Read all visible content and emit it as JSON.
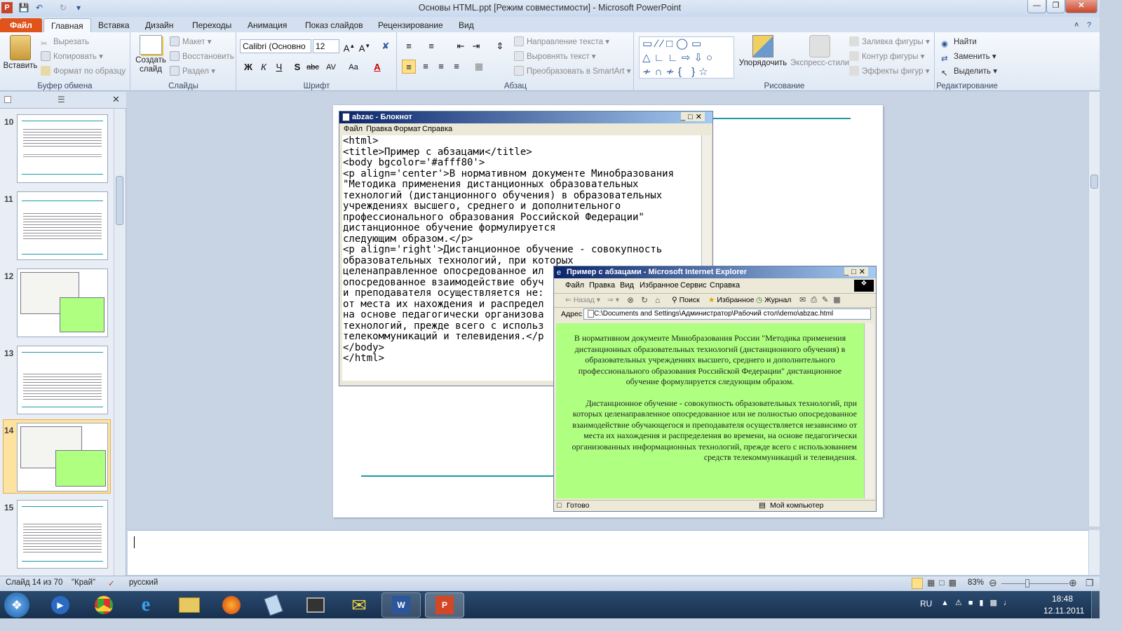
{
  "window": {
    "title": "Основы HTML.ppt [Режим совместимости]  -  Microsoft PowerPoint"
  },
  "tabs": [
    "Файл",
    "Главная",
    "Вставка",
    "Дизайн",
    "Переходы",
    "Анимация",
    "Показ слайдов",
    "Рецензирование",
    "Вид"
  ],
  "ribbon": {
    "clipboard": {
      "label": "Буфер обмена",
      "paste": "Вставить",
      "cut": "Вырезать",
      "copy": "Копировать",
      "format_painter": "Формат по образцу"
    },
    "slides": {
      "label": "Слайды",
      "new_slide": "Создать слайд",
      "layout": "Макет",
      "reset": "Восстановить",
      "section": "Раздел"
    },
    "font": {
      "label": "Шрифт",
      "font_name": "Calibri (Основно",
      "font_size": "12"
    },
    "paragraph": {
      "label": "Абзац",
      "text_direction": "Направление текста",
      "align_text": "Выровнять текст",
      "smartart": "Преобразовать в SmartArt"
    },
    "drawing": {
      "label": "Рисование",
      "arrange": "Упорядочить",
      "quick_styles": "Экспресс-стили",
      "shape_fill": "Заливка фигуры",
      "shape_outline": "Контур фигуры",
      "shape_effects": "Эффекты фигур"
    },
    "editing": {
      "label": "Редактирование",
      "find": "Найти",
      "replace": "Заменить",
      "select": "Выделить"
    }
  },
  "thumbnails": [
    {
      "num": "10"
    },
    {
      "num": "11"
    },
    {
      "num": "12"
    },
    {
      "num": "13"
    },
    {
      "num": "14"
    },
    {
      "num": "15"
    }
  ],
  "notepad": {
    "title": "abzac - Блокнот",
    "menu": [
      "Файл",
      "Правка",
      "Формат",
      "Справка"
    ],
    "text": "<html>\n<title>Пример с абзацами</title>\n<body bgcolor='#afff80'>\n<p align='center'>В нормативном документе Минобразования\n\"Методика применения дистанционных образовательных\nтехнологий (дистанционного обучения) в образовательных\nучреждениях высшего, среднего и дополнительного\nпрофессионального образования Российской Федерации\"\nдистанционное обучение формулируется\nследующим образом.</p>\n<p align='right'>Дистанционное обучение - совокупность\nобразовательных технологий, при которых\nцеленаправленное опосредованное ил\nопосредованное взаимодействие обуч\nи преподавателя осуществляется не:\nот места их нахождения и распредел\nна основе педагогически организова\nтехнологий, прежде всего с использ\nтелекоммуникаций и телевидения.</р\n</body>\n</html>"
  },
  "ie": {
    "title": "Пример с абзацами - Microsoft Internet Explorer",
    "menu": [
      "Файл",
      "Правка",
      "Вид",
      "Избранное",
      "Сервис",
      "Справка"
    ],
    "toolbar": {
      "back": "Назад",
      "search": "Поиск",
      "favorites": "Избранное",
      "history": "Журнал"
    },
    "address_label": "Адрес",
    "address": "C:\\Documents and Settings\\Администратор\\Рабочий стол\\demo\\abzac.html",
    "para1": "В нормативном документе Минобразования России \"Методика применения дистанционных образовательных технологий (дистанционного обучения) в образовательных учреждениях высшего, среднего и дополнительного профессионального образования Российской Федерации\" дистанционное обучение формулируется следующим образом.",
    "para2": "Дистанционное обучение - совокупность образовательных технологий, при которых целенаправленное опосредованное или не полностью опосредованное взаимодействие обучающегося и преподавателя осуществляется независимо от места их нахождения и распределения во времени, на основе педагогически организованных информационных технологий, прежде всего с использованием средств телекоммуникаций и телевидения.",
    "status": "Готово",
    "zone": "Мой компьютер",
    "bg_color": "#afff80"
  },
  "statusbar": {
    "slide": "Слайд 14 из 70",
    "theme": "\"Край\"",
    "language": "русский",
    "zoom": "83%"
  },
  "taskbar": {
    "lang": "RU",
    "time": "18:48",
    "date": "12.11.2011"
  },
  "colors": {
    "accent": "#e0531b",
    "slide_line": "#1a9aa8"
  }
}
